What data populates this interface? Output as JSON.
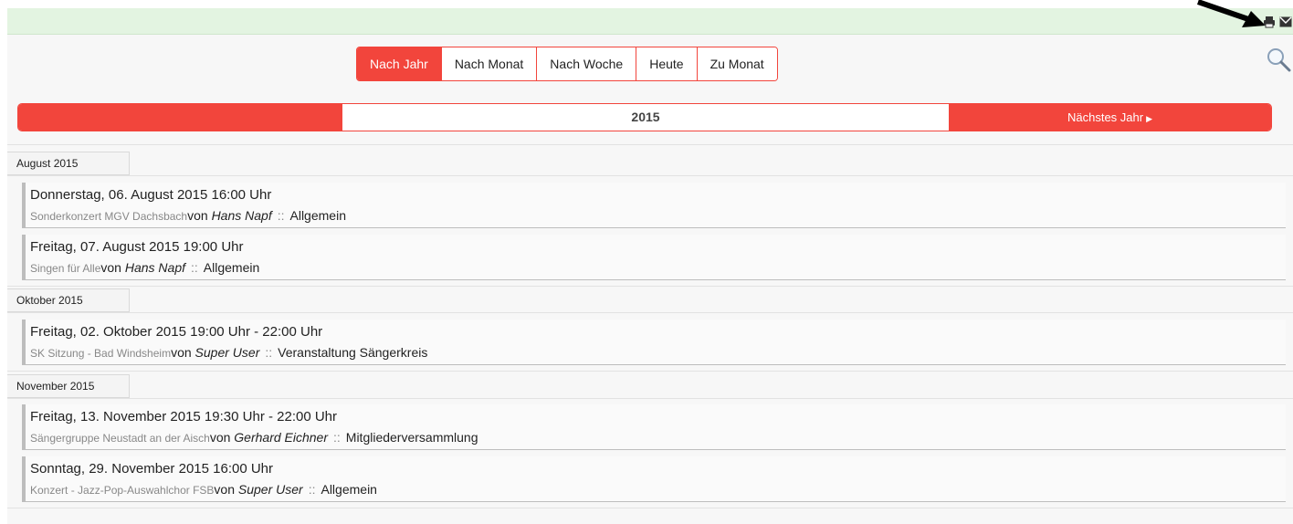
{
  "nav": {
    "buttons": [
      {
        "label": "Nach Jahr",
        "active": true
      },
      {
        "label": "Nach Monat",
        "active": false
      },
      {
        "label": "Nach Woche",
        "active": false
      },
      {
        "label": "Heute",
        "active": false
      },
      {
        "label": "Zu Monat",
        "active": false
      }
    ]
  },
  "yearbar": {
    "year": "2015",
    "next_label": "Nächstes Jahr"
  },
  "months": [
    {
      "label": "August 2015",
      "events": [
        {
          "date": "Donnerstag, 06. August 2015 16:00 Uhr",
          "title": "Sonderkonzert MGV Dachsbach",
          "by": "von",
          "author": "Hans Napf",
          "sep": "::",
          "category": "Allgemein"
        },
        {
          "date": "Freitag, 07. August 2015 19:00 Uhr",
          "title": "Singen für Alle",
          "by": "von",
          "author": "Hans Napf",
          "sep": "::",
          "category": "Allgemein"
        }
      ]
    },
    {
      "label": "Oktober 2015",
      "events": [
        {
          "date": "Freitag, 02. Oktober 2015 19:00 Uhr - 22:00 Uhr",
          "title": "SK Sitzung - Bad Windsheim",
          "by": "von",
          "author": "Super User",
          "sep": "::",
          "category": "Veranstaltung Sängerkreis"
        }
      ]
    },
    {
      "label": "November 2015",
      "events": [
        {
          "date": "Freitag, 13. November 2015 19:30 Uhr - 22:00 Uhr",
          "title": "Sängergruppe Neustadt an der Aisch",
          "by": "von",
          "author": "Gerhard Eichner",
          "sep": "::",
          "category": "Mitgliederversammlung"
        },
        {
          "date": "Sonntag, 29. November 2015 16:00 Uhr",
          "title": "Konzert - Jazz-Pop-Auswahlchor FSB",
          "by": "von",
          "author": "Super User",
          "sep": "::",
          "category": "Allgemein"
        }
      ]
    }
  ],
  "colors": {
    "accent": "#f2453c",
    "topstrip": "#e3f4e1",
    "background": "#f7f7f7"
  }
}
